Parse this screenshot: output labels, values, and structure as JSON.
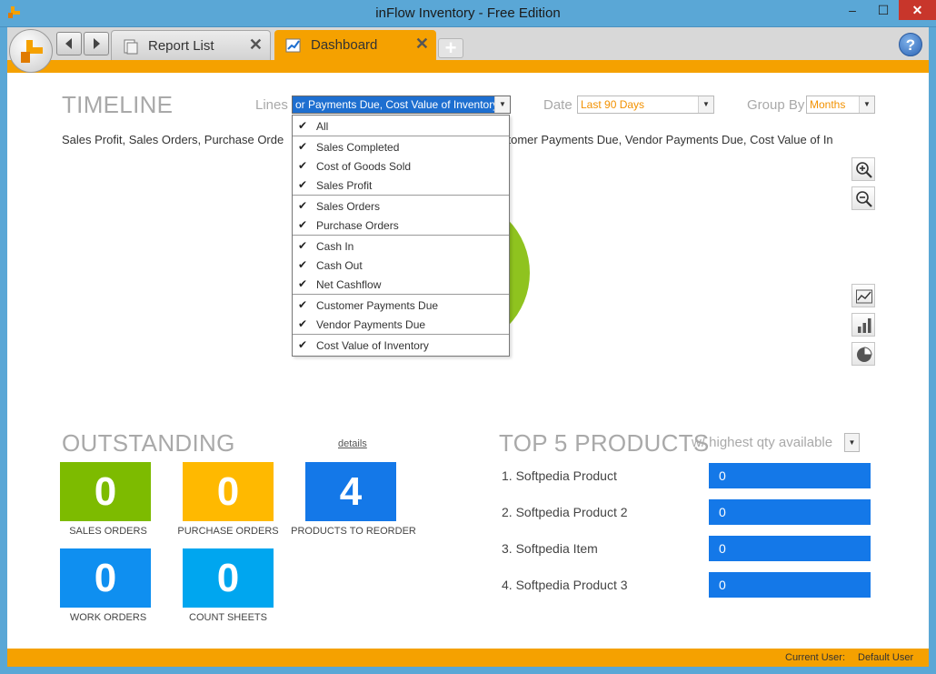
{
  "window": {
    "title": "inFlow Inventory - Free Edition",
    "min": "–",
    "max": "☐",
    "close": "✕"
  },
  "tabs": [
    {
      "label": "Report List",
      "close": "✕"
    },
    {
      "label": "Dashboard",
      "close": "✕"
    }
  ],
  "tab_add": "+",
  "help": "?",
  "timeline": {
    "title": "TIMELINE",
    "lines_label": "Lines",
    "lines_value": "or Payments Due, Cost Value of Inventory",
    "date_label": "Date",
    "date_value": "Last 90 Days",
    "groupby_label": "Group By",
    "groupby_value": "Months",
    "series_text": "Sales Profit,  Sales Orders,  Purchase Orde",
    "series_text_right": "stomer Payments Due,  Vendor Payments Due,  Cost Value of In"
  },
  "dropdown": {
    "items": [
      {
        "label": "All",
        "checked": "✔"
      },
      {
        "label": "Sales Completed",
        "checked": "✔"
      },
      {
        "label": "Cost of Goods Sold",
        "checked": "✔"
      },
      {
        "label": "Sales Profit",
        "checked": "✔"
      },
      {
        "label": "Sales Orders",
        "checked": "✔"
      },
      {
        "label": "Purchase Orders",
        "checked": "✔"
      },
      {
        "label": "Cash In",
        "checked": "✔"
      },
      {
        "label": "Cash Out",
        "checked": "✔"
      },
      {
        "label": "Net Cashflow",
        "checked": "✔"
      },
      {
        "label": "Customer Payments Due",
        "checked": "✔"
      },
      {
        "label": "Vendor Payments Due",
        "checked": "✔"
      },
      {
        "label": "Cost Value of Inventory",
        "checked": "✔"
      }
    ]
  },
  "outstanding": {
    "title": "OUTSTANDING",
    "details": "details",
    "tiles": [
      {
        "value": "0",
        "label": "SALES ORDERS",
        "color": "#7dbb00"
      },
      {
        "value": "0",
        "label": "PURCHASE ORDERS",
        "color": "#ffb900"
      },
      {
        "value": "4",
        "label": "PRODUCTS TO REORDER",
        "color": "#1478e8"
      },
      {
        "value": "0",
        "label": "WORK ORDERS",
        "color": "#0f8ff0"
      },
      {
        "value": "0",
        "label": "COUNT SHEETS",
        "color": "#00a6ef"
      }
    ]
  },
  "top_products": {
    "title": "TOP 5 PRODUCTS",
    "subtitle": "w/ highest qty available",
    "items": [
      {
        "name": "1. Softpedia Product",
        "qty": "0"
      },
      {
        "name": "2. Softpedia Product 2",
        "qty": "0"
      },
      {
        "name": "3. Softpedia Item",
        "qty": "0"
      },
      {
        "name": "4. Softpedia Product 3",
        "qty": "0"
      }
    ]
  },
  "status": {
    "label": "Current User:",
    "user": "Default User"
  },
  "colors": {
    "accent": "#f5a100",
    "titlebar": "#5aa7d6",
    "pie": "#8fc31f"
  }
}
